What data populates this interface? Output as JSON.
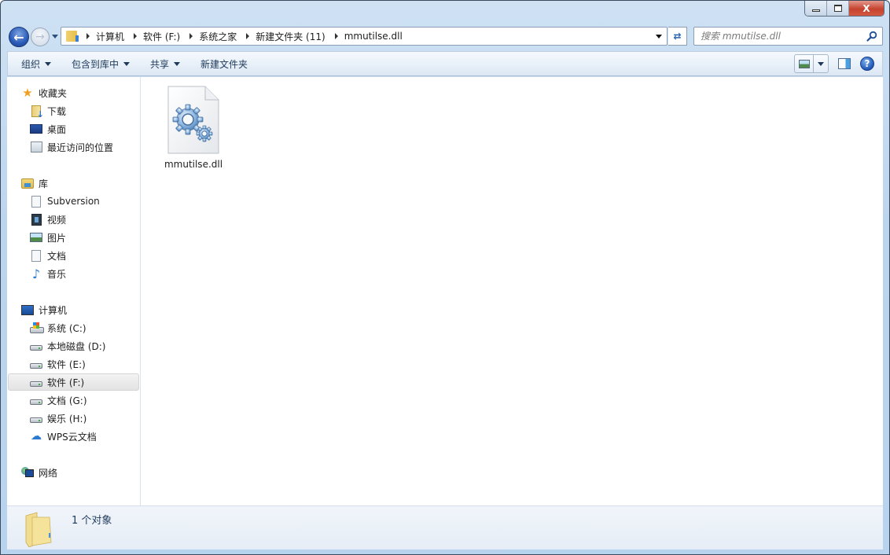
{
  "window": {
    "caption_buttons": {
      "minimize": "minimize",
      "maximize": "maximize",
      "close": "X"
    }
  },
  "navigation": {
    "back_icon": "back-arrow-icon",
    "forward_icon": "forward-arrow-icon",
    "breadcrumbs": [
      "计算机",
      "软件 (F:)",
      "系统之家",
      "新建文件夹 (11)",
      "mmutilse.dll"
    ],
    "refresh_icon": "refresh-icon",
    "search_placeholder": "搜索 mmutilse.dll"
  },
  "toolbar": {
    "organize": "组织",
    "include_in_library": "包含到库中",
    "share": "共享",
    "new_folder": "新建文件夹",
    "help_label": "?"
  },
  "sidebar": {
    "favorites": {
      "label": "收藏夹",
      "items": [
        {
          "label": "下载",
          "icon": "downloads-icon"
        },
        {
          "label": "桌面",
          "icon": "desktop-icon"
        },
        {
          "label": "最近访问的位置",
          "icon": "recent-places-icon"
        }
      ]
    },
    "libraries": {
      "label": "库",
      "items": [
        {
          "label": "Subversion",
          "icon": "document-icon"
        },
        {
          "label": "视频",
          "icon": "video-icon"
        },
        {
          "label": "图片",
          "icon": "pictures-icon"
        },
        {
          "label": "文档",
          "icon": "documents-icon"
        },
        {
          "label": "音乐",
          "icon": "music-icon"
        }
      ]
    },
    "computer": {
      "label": "计算机",
      "items": [
        {
          "label": "系统 (C:)",
          "icon": "system-drive-icon"
        },
        {
          "label": "本地磁盘 (D:)",
          "icon": "drive-icon"
        },
        {
          "label": "软件 (E:)",
          "icon": "drive-icon"
        },
        {
          "label": "软件 (F:)",
          "icon": "drive-icon",
          "selected": true
        },
        {
          "label": "文档 (G:)",
          "icon": "drive-icon"
        },
        {
          "label": "娱乐 (H:)",
          "icon": "drive-icon"
        },
        {
          "label": "WPS云文档",
          "icon": "cloud-icon"
        }
      ]
    },
    "network": {
      "label": "网络"
    }
  },
  "content": {
    "files": [
      {
        "name": "mmutilse.dll",
        "icon": "dll-gear-file-icon"
      }
    ]
  },
  "statusbar": {
    "text": "1 个对象"
  }
}
